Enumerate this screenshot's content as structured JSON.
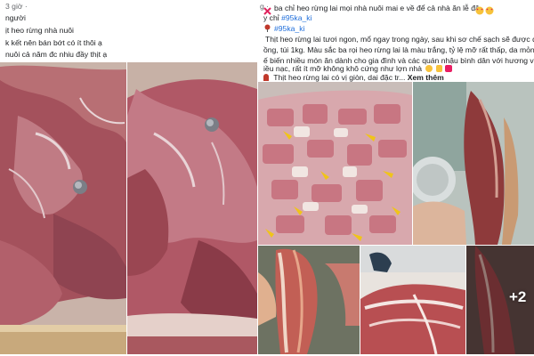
{
  "left_post": {
    "meta": "3 giờ ·",
    "lines": [
      "người",
      "ịt heo rừng nhà nuôi",
      "k kết nên bán bớt có ít thôi ạ",
      "nuôi cả năm đc nhiu đầy thịt ạ"
    ]
  },
  "right_post": {
    "meta": "g ·",
    "header_line": "ba chỉ heo rừng lai mọi nhà nuôi mai e về để cả nhà ăn lễ đây ạ",
    "header_icons": [
      "cross-icon",
      "heart-eyes-icon",
      "heart-eyes-icon"
    ],
    "hashtag_lines": [
      {
        "prefix": "y chỉ ",
        "tag": "#95ka_ki"
      },
      {
        "prefix": "",
        "tag": "#95ka_ki"
      }
    ],
    "body_lines": [
      "Thịt heo rừng lai tươi ngon, mổ ngay trong ngày, sau khi sơ chế sạch sẽ được đóng gói",
      "ồng, túi 1kg. Màu sắc ba rọi heo rừng lai là màu trắng, tỷ lệ mỡ rất thấp, da mỏng, thường",
      "ế biến nhiều món ăn dành cho gia đình và các quán nhậu bình dân với hương vị rất thơm",
      "iều nạc, rất ít mỡ không khô cứng như lợn nhà"
    ],
    "last_line": "Thịt heo rừng lai có vị giòn, dai đặc tr...",
    "see_more": "Xem thêm"
  },
  "photo_grid": {
    "more_count": "+2"
  }
}
